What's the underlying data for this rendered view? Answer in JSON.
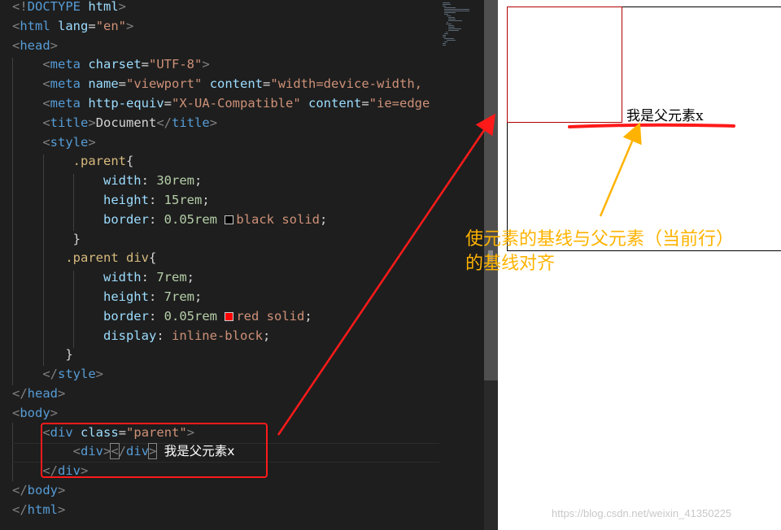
{
  "code": {
    "lines": [
      [
        [
          "punc",
          "<!"
        ],
        [
          "tag",
          "DOCTYPE"
        ],
        [
          "txt",
          " "
        ],
        [
          "attr",
          "html"
        ],
        [
          "punc",
          ">"
        ]
      ],
      [
        [
          "punc",
          "<"
        ],
        [
          "tag",
          "html"
        ],
        [
          "txt",
          " "
        ],
        [
          "attr",
          "lang"
        ],
        [
          "txt",
          "="
        ],
        [
          "str",
          "\"en\""
        ],
        [
          "punc",
          ">"
        ]
      ],
      [
        [
          "punc",
          "<"
        ],
        [
          "tag",
          "head"
        ],
        [
          "punc",
          ">"
        ]
      ],
      [
        [
          "txt",
          "    "
        ],
        [
          "punc",
          "<"
        ],
        [
          "tag",
          "meta"
        ],
        [
          "txt",
          " "
        ],
        [
          "attr",
          "charset"
        ],
        [
          "txt",
          "="
        ],
        [
          "str",
          "\"UTF-8\""
        ],
        [
          "punc",
          ">"
        ]
      ],
      [
        [
          "txt",
          "    "
        ],
        [
          "punc",
          "<"
        ],
        [
          "tag",
          "meta"
        ],
        [
          "txt",
          " "
        ],
        [
          "attr",
          "name"
        ],
        [
          "txt",
          "="
        ],
        [
          "str",
          "\"viewport\""
        ],
        [
          "txt",
          " "
        ],
        [
          "attr",
          "content"
        ],
        [
          "txt",
          "="
        ],
        [
          "str",
          "\"width=device-width, "
        ]
      ],
      [
        [
          "txt",
          "    "
        ],
        [
          "punc",
          "<"
        ],
        [
          "tag",
          "meta"
        ],
        [
          "txt",
          " "
        ],
        [
          "attr",
          "http-equiv"
        ],
        [
          "txt",
          "="
        ],
        [
          "str",
          "\"X-UA-Compatible\""
        ],
        [
          "txt",
          " "
        ],
        [
          "attr",
          "content"
        ],
        [
          "txt",
          "="
        ],
        [
          "str",
          "\"ie=edge"
        ]
      ],
      [
        [
          "txt",
          "    "
        ],
        [
          "punc",
          "<"
        ],
        [
          "tag",
          "title"
        ],
        [
          "punc",
          ">"
        ],
        [
          "txt",
          "Document"
        ],
        [
          "punc",
          "</"
        ],
        [
          "tag",
          "title"
        ],
        [
          "punc",
          ">"
        ]
      ],
      [
        [
          "txt",
          "    "
        ],
        [
          "punc",
          "<"
        ],
        [
          "tag",
          "style"
        ],
        [
          "punc",
          ">"
        ]
      ],
      [
        [
          "txt",
          "        "
        ],
        [
          "sel",
          ".parent"
        ],
        [
          "txt",
          "{"
        ]
      ],
      [
        [
          "txt",
          "            "
        ],
        [
          "prop",
          "width"
        ],
        [
          "txt",
          ": "
        ],
        [
          "num",
          "30rem"
        ],
        [
          "txt",
          ";"
        ]
      ],
      [
        [
          "txt",
          "            "
        ],
        [
          "prop",
          "height"
        ],
        [
          "txt",
          ": "
        ],
        [
          "num",
          "15rem"
        ],
        [
          "txt",
          ";"
        ]
      ],
      [
        [
          "txt",
          "            "
        ],
        [
          "prop",
          "border"
        ],
        [
          "txt",
          ": "
        ],
        [
          "num",
          "0.05rem"
        ],
        [
          "txt",
          " "
        ],
        [
          "swatch",
          "#000000"
        ],
        [
          "val",
          "black solid"
        ],
        [
          "txt",
          ";"
        ]
      ],
      [
        [
          "txt",
          "        }"
        ]
      ],
      [
        [
          "txt",
          "       "
        ],
        [
          "sel",
          ".parent div"
        ],
        [
          "txt",
          "{"
        ]
      ],
      [
        [
          "txt",
          "            "
        ],
        [
          "prop",
          "width"
        ],
        [
          "txt",
          ": "
        ],
        [
          "num",
          "7rem"
        ],
        [
          "txt",
          ";"
        ]
      ],
      [
        [
          "txt",
          "            "
        ],
        [
          "prop",
          "height"
        ],
        [
          "txt",
          ": "
        ],
        [
          "num",
          "7rem"
        ],
        [
          "txt",
          ";"
        ]
      ],
      [
        [
          "txt",
          "            "
        ],
        [
          "prop",
          "border"
        ],
        [
          "txt",
          ": "
        ],
        [
          "num",
          "0.05rem"
        ],
        [
          "txt",
          " "
        ],
        [
          "swatch",
          "#ff0000"
        ],
        [
          "val",
          "red solid"
        ],
        [
          "txt",
          ";"
        ]
      ],
      [
        [
          "txt",
          "            "
        ],
        [
          "prop",
          "display"
        ],
        [
          "txt",
          ": "
        ],
        [
          "val",
          "inline-block"
        ],
        [
          "txt",
          ";"
        ]
      ],
      [
        [
          "txt",
          "       }"
        ]
      ],
      [
        [
          "txt",
          "    "
        ],
        [
          "punc",
          "</"
        ],
        [
          "tag",
          "style"
        ],
        [
          "punc",
          ">"
        ]
      ],
      [
        [
          "punc",
          "</"
        ],
        [
          "tag",
          "head"
        ],
        [
          "punc",
          ">"
        ]
      ],
      [
        [
          "punc",
          "<"
        ],
        [
          "tag",
          "body"
        ],
        [
          "punc",
          ">"
        ]
      ],
      [
        [
          "txt",
          "    "
        ],
        [
          "punc",
          "<"
        ],
        [
          "tag",
          "div"
        ],
        [
          "txt",
          " "
        ],
        [
          "attr",
          "class"
        ],
        [
          "txt",
          "="
        ],
        [
          "str",
          "\"parent\""
        ],
        [
          "punc",
          ">"
        ]
      ],
      [
        [
          "txt",
          "        "
        ],
        [
          "punc",
          "<"
        ],
        [
          "tag",
          "div"
        ],
        [
          "punc",
          ">"
        ],
        [
          "hl",
          "<"
        ],
        [
          "punc",
          "/"
        ],
        [
          "tag",
          "div"
        ],
        [
          "hl",
          ">"
        ],
        [
          "txt",
          " "
        ],
        [
          "cjk",
          "我是父元素x"
        ]
      ],
      [
        [
          "txt",
          "    "
        ],
        [
          "punc",
          "</"
        ],
        [
          "tag",
          "div"
        ],
        [
          "punc",
          ">"
        ]
      ],
      [
        [
          "punc",
          "</"
        ],
        [
          "tag",
          "body"
        ],
        [
          "punc",
          ">"
        ]
      ],
      [
        [
          "punc",
          "</"
        ],
        [
          "tag",
          "html"
        ],
        [
          "punc",
          ">"
        ]
      ]
    ]
  },
  "preview": {
    "parent_text": "我是父元素x"
  },
  "annotation": {
    "text": "使元素的基线与父元素（当前行）的基线对齐"
  },
  "watermark": "https://blog.csdn.net/weixin_41350225",
  "colors": {
    "editor_bg": "#1e1e1e",
    "tag": "#569cd6",
    "attr": "#9cdcfe",
    "string": "#ce9178",
    "number": "#b5cea8",
    "annotation": "#ffb300",
    "highlight_box": "#ff1a1a",
    "arrow_red": "#ff1a1a",
    "arrow_yellow": "#ffb300"
  }
}
